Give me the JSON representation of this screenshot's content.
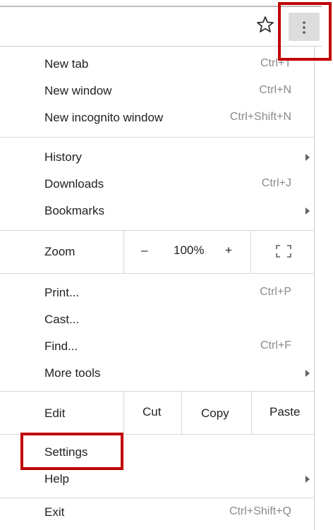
{
  "toolbar": {
    "star_icon": "star-outline-icon",
    "menu_icon": "three-dot-menu-icon"
  },
  "menu": {
    "new_tab": {
      "label": "New tab",
      "shortcut": "Ctrl+T"
    },
    "new_window": {
      "label": "New window",
      "shortcut": "Ctrl+N"
    },
    "new_incognito": {
      "label": "New incognito window",
      "shortcut": "Ctrl+Shift+N"
    },
    "history": {
      "label": "History"
    },
    "downloads": {
      "label": "Downloads",
      "shortcut": "Ctrl+J"
    },
    "bookmarks": {
      "label": "Bookmarks"
    },
    "zoom": {
      "label": "Zoom",
      "minus": "–",
      "level": "100%",
      "plus": "+",
      "fullscreen_icon": "fullscreen-icon"
    },
    "print": {
      "label": "Print...",
      "shortcut": "Ctrl+P"
    },
    "cast": {
      "label": "Cast..."
    },
    "find": {
      "label": "Find...",
      "shortcut": "Ctrl+F"
    },
    "more_tools": {
      "label": "More tools"
    },
    "edit": {
      "label": "Edit",
      "cut": "Cut",
      "copy": "Copy",
      "paste": "Paste"
    },
    "settings": {
      "label": "Settings"
    },
    "help": {
      "label": "Help"
    },
    "exit": {
      "label": "Exit",
      "shortcut": "Ctrl+Shift+Q"
    }
  },
  "highlight_color": "#c00000"
}
